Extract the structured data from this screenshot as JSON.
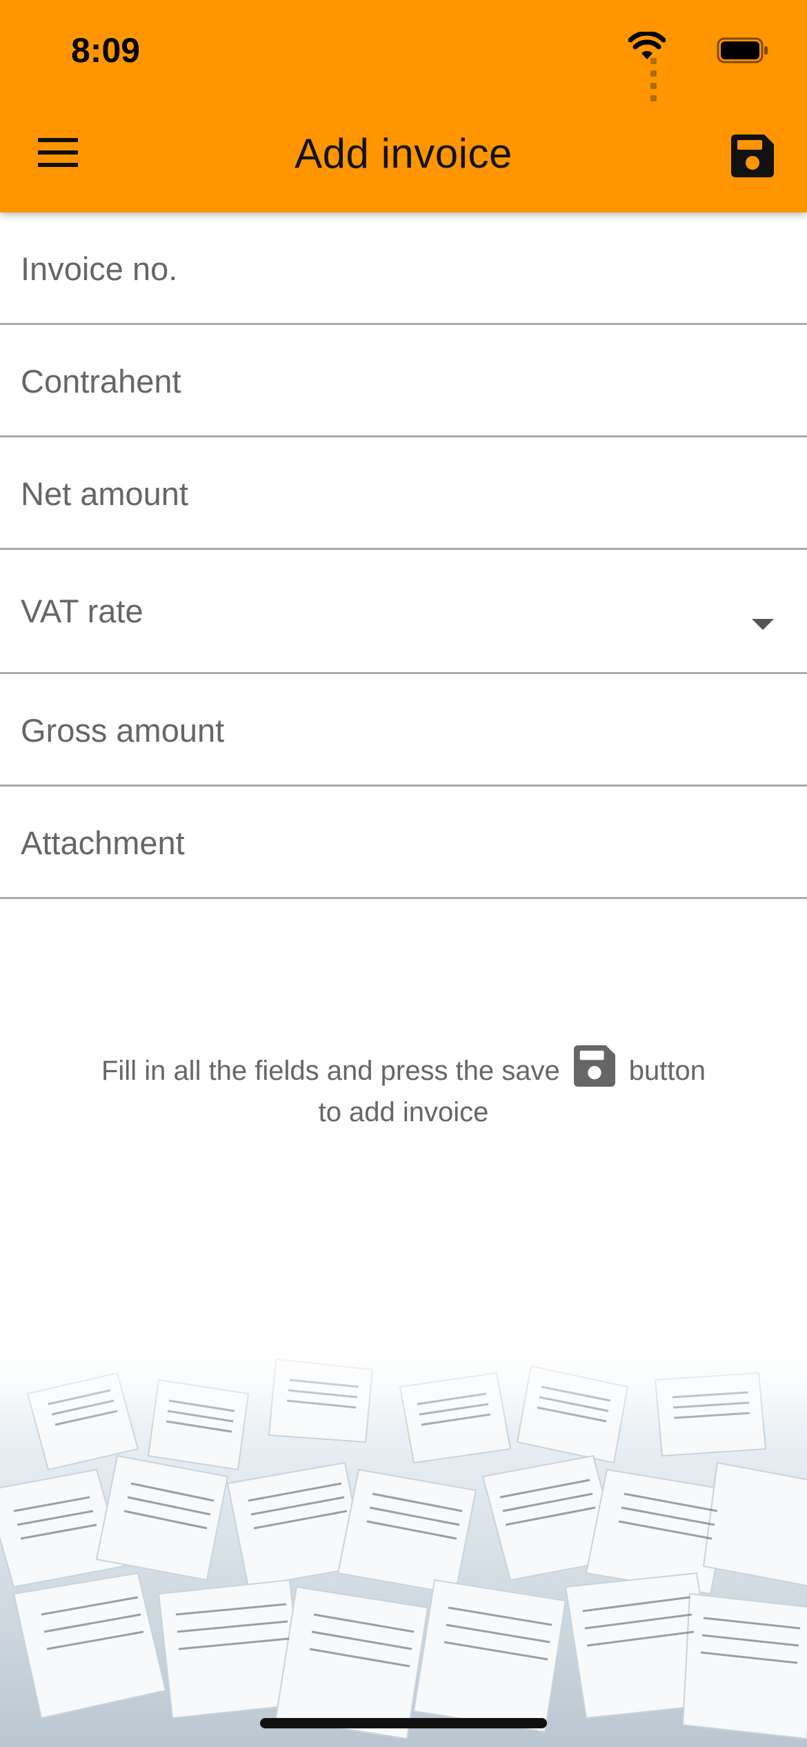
{
  "status_bar": {
    "time": "8:09",
    "icons": [
      "signal-icon",
      "wifi-icon",
      "battery-icon"
    ]
  },
  "header": {
    "title": "Add invoice",
    "background_color": "#FF9500",
    "menu_icon": "hamburger-menu-icon",
    "save_icon": "floppy-disk-save-icon"
  },
  "form": {
    "invoice_no": {
      "placeholder": "Invoice no.",
      "value": ""
    },
    "contrahent": {
      "placeholder": "Contrahent",
      "value": ""
    },
    "net_amount": {
      "placeholder": "Net amount",
      "value": ""
    },
    "vat_rate": {
      "label": "VAT rate",
      "selected": ""
    },
    "gross_amount": {
      "placeholder": "Gross amount",
      "value": ""
    },
    "attachment": {
      "placeholder": "Attachment",
      "value": ""
    }
  },
  "hint": {
    "text_before": "Fill in all the fields and press the save",
    "text_after": "button",
    "line2": "to add invoice",
    "icon": "floppy-disk-save-icon"
  },
  "background_image": {
    "description_icon": "scattered-papers-illustration"
  }
}
